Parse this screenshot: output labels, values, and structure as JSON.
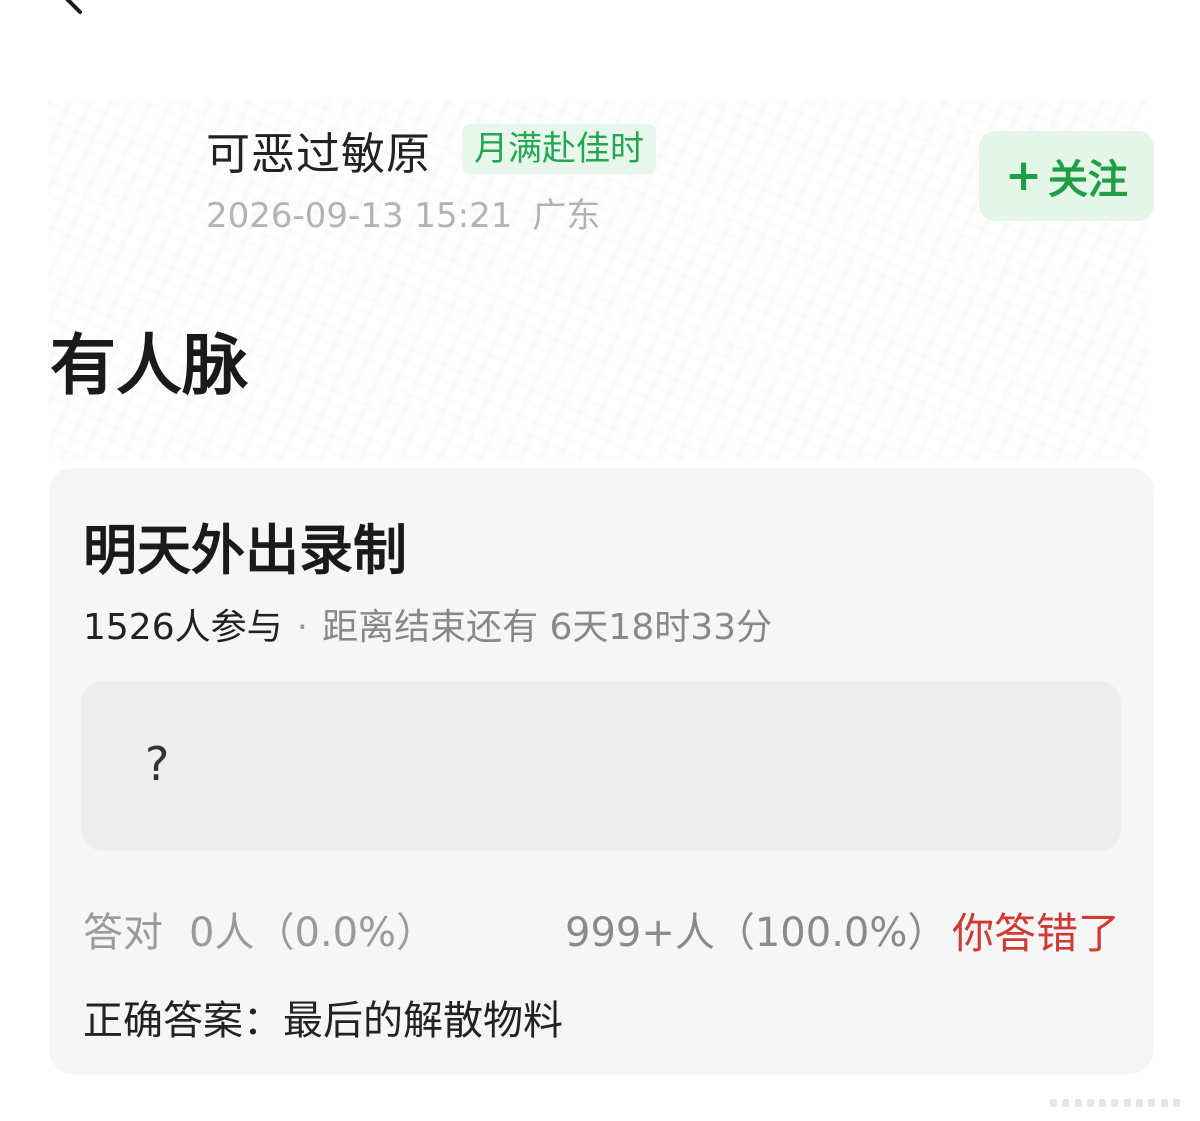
{
  "header": {
    "back_icon": "chevron-left-icon"
  },
  "author": {
    "name": "可恶过敏原",
    "badge": "月满赴佳时",
    "date": "2026-09-13 15:21",
    "location": "广东",
    "follow_label": "关注",
    "follow_icon": "+"
  },
  "post": {
    "title": "有人脉"
  },
  "quiz": {
    "title": "明天外出录制",
    "participants": "1526人参与",
    "separator": "·",
    "countdown": "距离结束还有 6天18时33分",
    "option_text": "?",
    "correct_label": "答对",
    "correct_count": "0人（0.0%）",
    "wrong_count": "999+人（100.0%）",
    "status": "你答错了",
    "answer": "正确答案：最后的解散物料"
  },
  "colors": {
    "accent_green": "#1f9e44",
    "badge_green": "#26a552",
    "error_red": "#d03a34"
  }
}
